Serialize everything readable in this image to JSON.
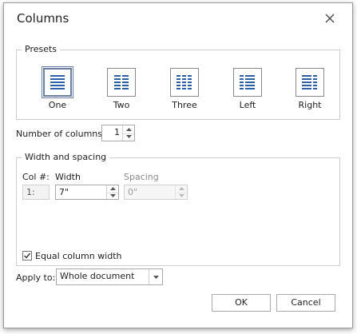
{
  "dialog": {
    "title": "Columns"
  },
  "presets": {
    "legend": "Presets",
    "items": [
      {
        "label": "One",
        "icon": "one-column-icon",
        "selected": true
      },
      {
        "label": "Two",
        "icon": "two-columns-icon",
        "selected": false
      },
      {
        "label": "Three",
        "icon": "three-columns-icon",
        "selected": false
      },
      {
        "label": "Left",
        "icon": "left-column-icon",
        "selected": false
      },
      {
        "label": "Right",
        "icon": "right-column-icon",
        "selected": false
      }
    ]
  },
  "number_of_columns": {
    "label": "Number of columns:",
    "value": "1"
  },
  "width_spacing": {
    "legend": "Width and spacing",
    "col_header": "Col #:",
    "width_header": "Width",
    "spacing_header": "Spacing",
    "col_value": "1:",
    "width_value": "7\"",
    "spacing_value": "0\""
  },
  "equal_width": {
    "label": "Equal column width",
    "checked": true
  },
  "apply_to": {
    "label": "Apply to:",
    "value": "Whole document"
  },
  "buttons": {
    "ok": "OK",
    "cancel": "Cancel"
  },
  "colors": {
    "icon_blue": "#2d5fa8",
    "selected_border": "#6b7fa0"
  }
}
